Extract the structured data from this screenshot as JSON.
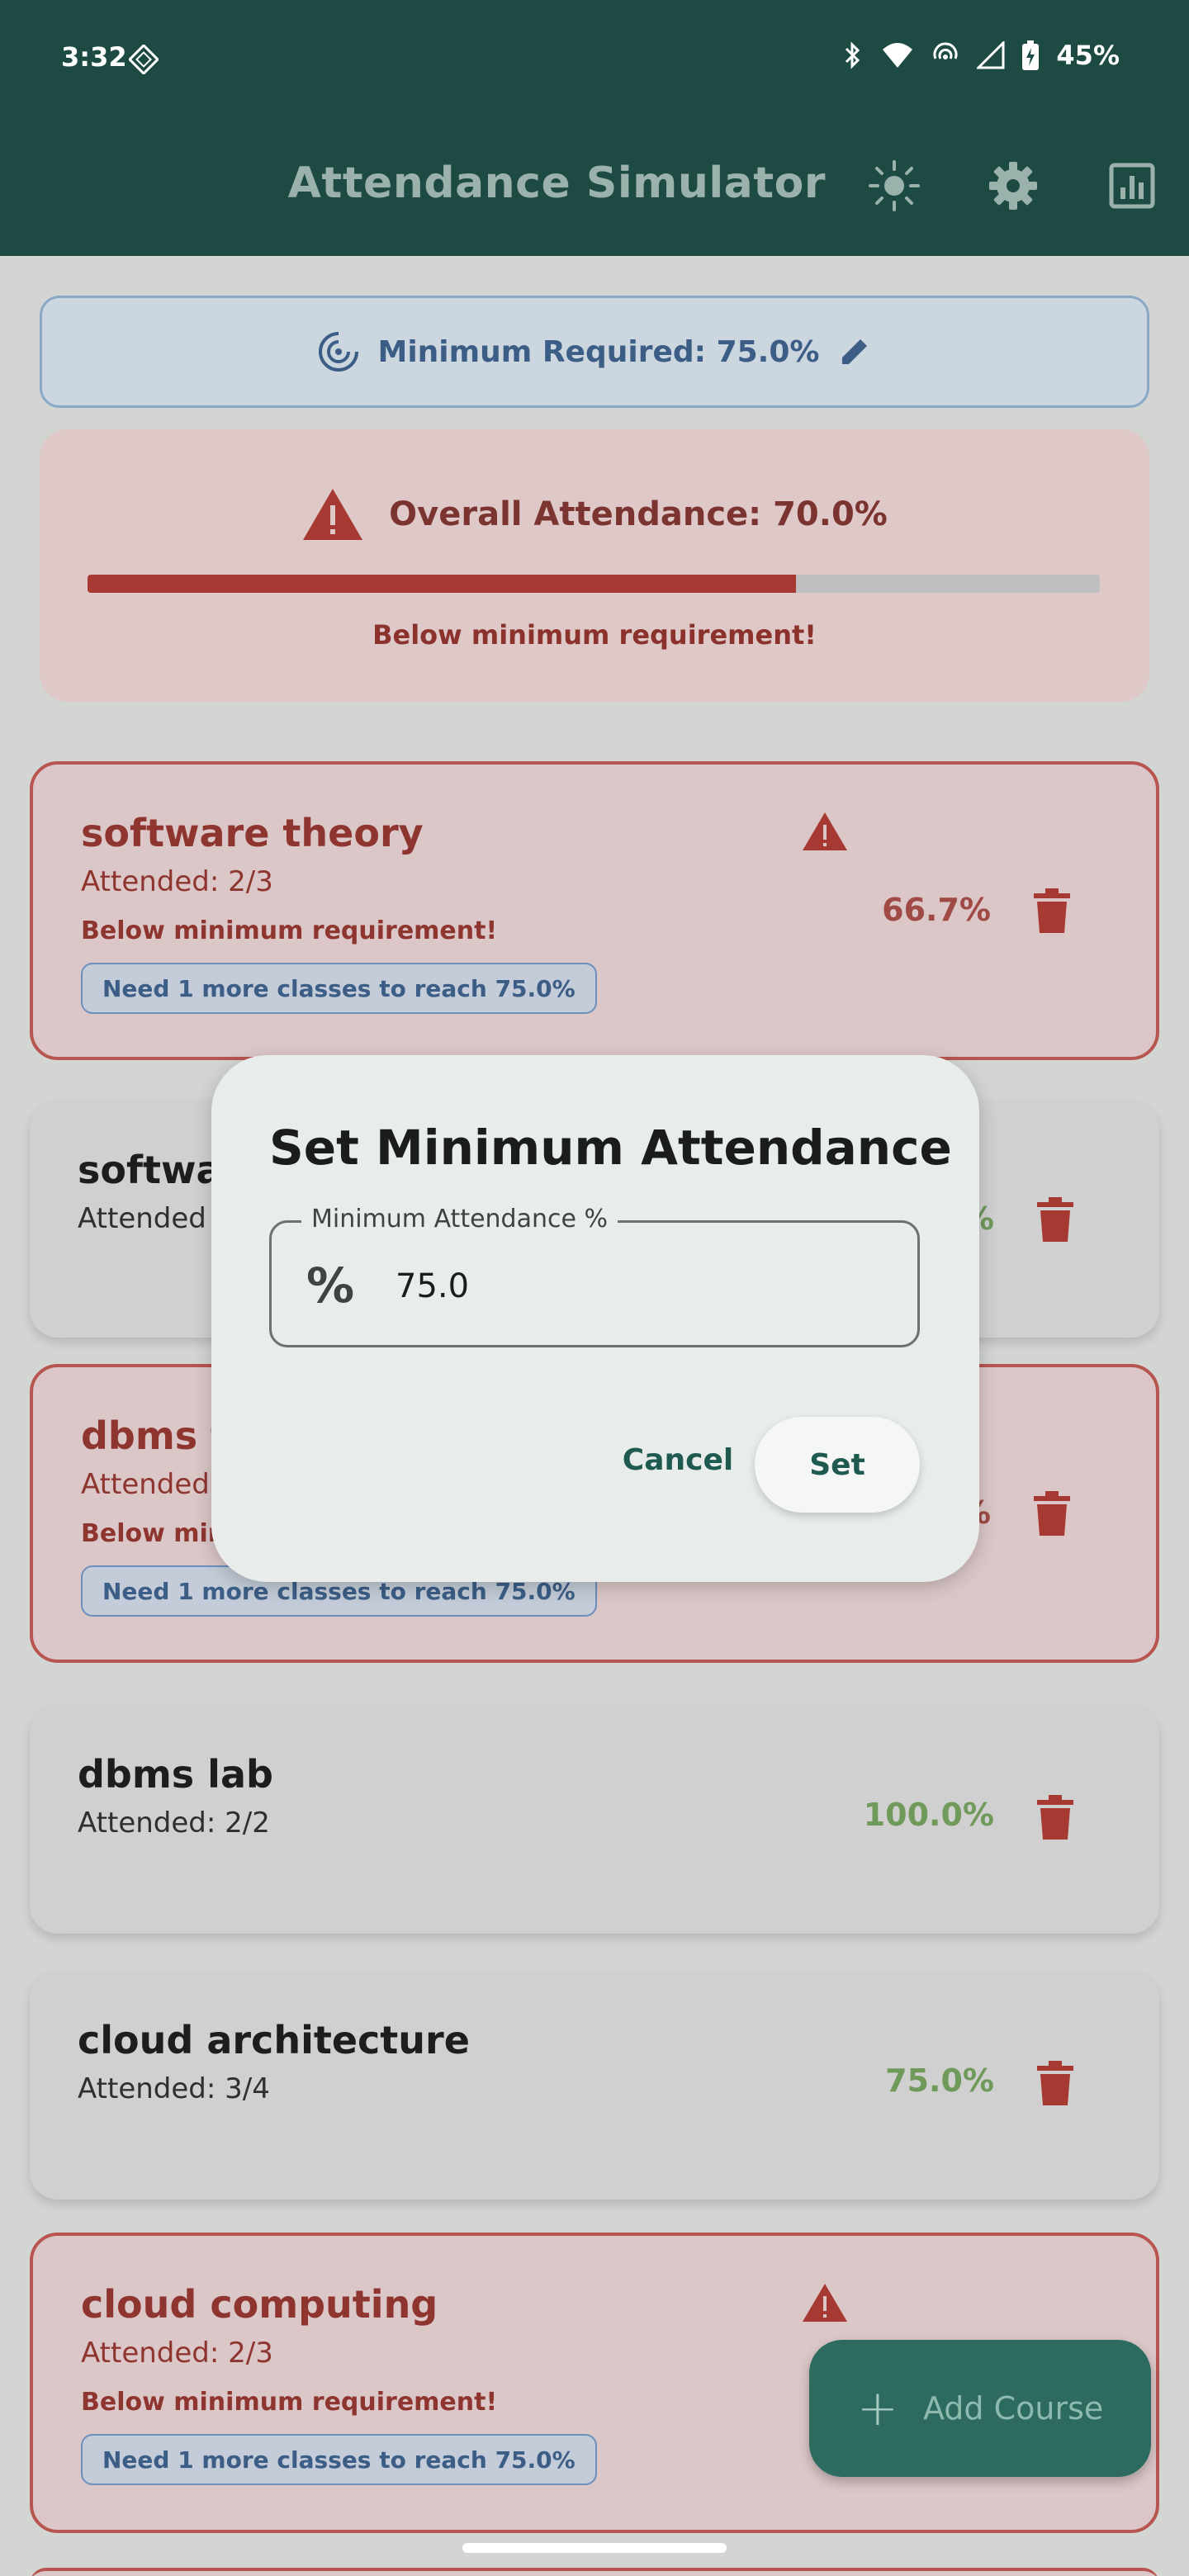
{
  "status_bar": {
    "time": "3:32",
    "battery": "45%"
  },
  "app_bar": {
    "title": "Attendance Simulator"
  },
  "min_required": {
    "label": "Minimum Required: 75.0%"
  },
  "overall": {
    "label": "Overall Attendance: 70.0%",
    "progress_percent": 70.0,
    "note": "Below minimum requirement!"
  },
  "courses": [
    {
      "name": "software theory",
      "attended": "Attended: 2/3",
      "percent": "66.7%",
      "below": "Below minimum requirement!",
      "need": "Need 1 more classes to reach 75.0%"
    },
    {
      "name": "softwa",
      "attended": "Attended",
      "percent": "%"
    },
    {
      "name": "dbms t",
      "attended": "Attended",
      "percent": "%",
      "below": "Below min",
      "need": "Need 1 more classes to reach 75.0%"
    },
    {
      "name": "dbms lab",
      "attended": "Attended: 2/2",
      "percent": "100.0%"
    },
    {
      "name": "cloud architecture",
      "attended": "Attended: 3/4",
      "percent": "75.0%"
    },
    {
      "name": "cloud computing",
      "attended": "Attended: 2/3",
      "below": "Below minimum requirement!",
      "need": "Need 1 more classes to reach 75.0%"
    }
  ],
  "dialog": {
    "title": "Set Minimum Attendance",
    "field_label": "Minimum Attendance %",
    "field_value": "75.0",
    "field_icon": "%",
    "cancel": "Cancel",
    "set": "Set"
  },
  "fab": {
    "label": "Add Course"
  },
  "colors": {
    "primary": "#1d4b43",
    "warning": "#a63a33",
    "ok": "#6f9a5a",
    "info": "#3c5e86"
  }
}
